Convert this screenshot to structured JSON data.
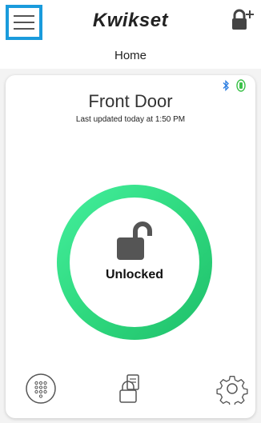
{
  "header": {
    "brand": "Kwikset",
    "page_title": "Home"
  },
  "lock": {
    "name": "Front Door",
    "last_updated": "Last updated today at 1:50 PM",
    "status": "Unlocked"
  },
  "colors": {
    "accent_blue": "#1a9bdc",
    "ring_green": "#2fd97f",
    "battery_green": "#3cc24a",
    "bluetooth_blue": "#2a7de1"
  },
  "icons": {
    "menu": "hamburger-icon",
    "add_lock": "add-lock-icon",
    "bluetooth": "bluetooth-icon",
    "battery": "battery-icon",
    "padlock": "unlocked-padlock-icon",
    "keypad": "keypad-icon",
    "user_codes": "user-codes-icon",
    "settings": "gear-icon"
  }
}
